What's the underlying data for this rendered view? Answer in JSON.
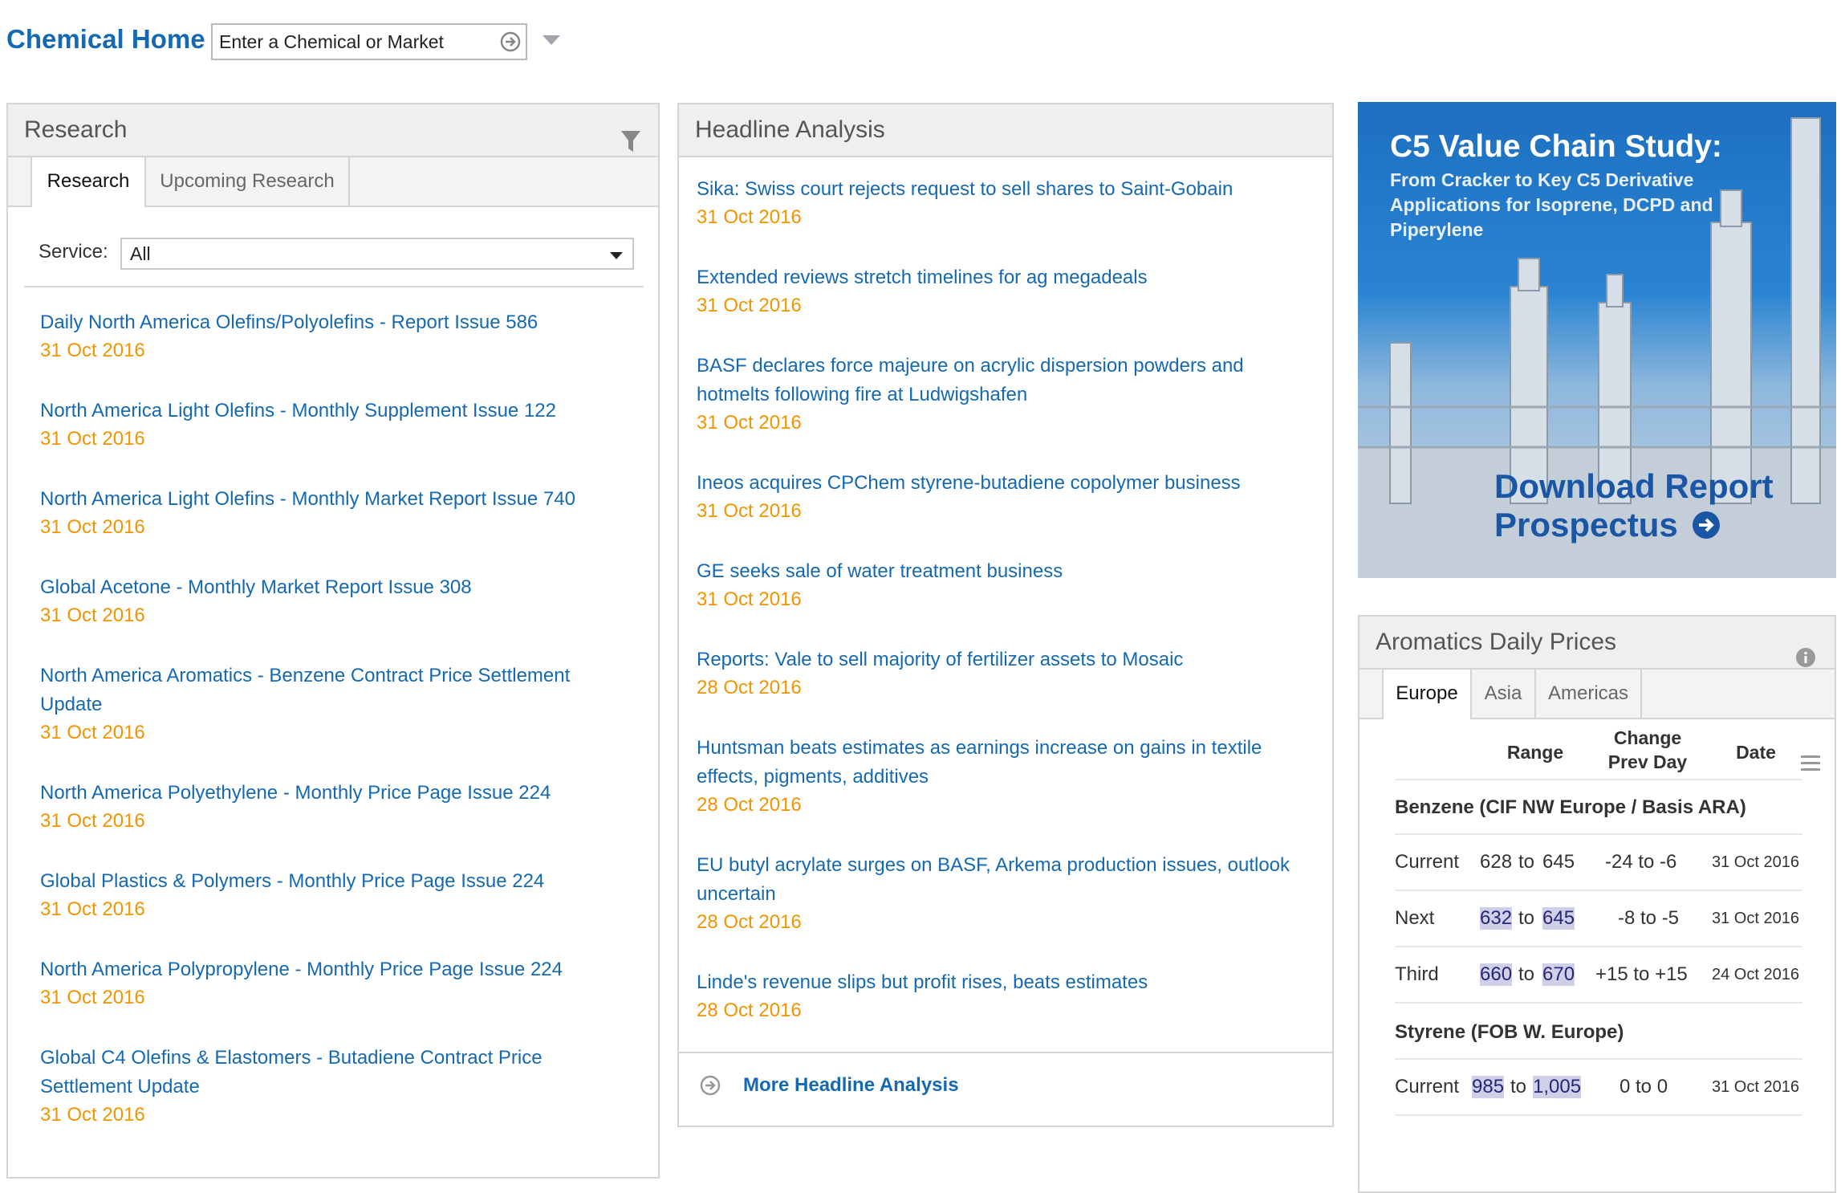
{
  "header": {
    "title": "Chemical Home",
    "search_placeholder": "Enter a Chemical or Market"
  },
  "research": {
    "title": "Research",
    "tabs": [
      "Research",
      "Upcoming Research"
    ],
    "service_label": "Service:",
    "service_value": "All",
    "items": [
      {
        "title": "Daily North America Olefins/Polyolefins - Report Issue 586",
        "date": "31 Oct 2016"
      },
      {
        "title": "North America Light Olefins - Monthly Supplement Issue 122",
        "date": "31 Oct 2016"
      },
      {
        "title": "North America Light Olefins - Monthly Market Report Issue 740",
        "date": "31 Oct 2016"
      },
      {
        "title": "Global Acetone - Monthly Market Report Issue 308",
        "date": "31 Oct 2016"
      },
      {
        "title": "North America Aromatics - Benzene Contract Price Settlement Update",
        "date": "31 Oct 2016"
      },
      {
        "title": "North America Polyethylene - Monthly Price Page Issue 224",
        "date": "31 Oct 2016"
      },
      {
        "title": "Global Plastics & Polymers - Monthly Price Page Issue 224",
        "date": "31 Oct 2016"
      },
      {
        "title": "North America Polypropylene - Monthly Price Page Issue 224",
        "date": "31 Oct 2016"
      },
      {
        "title": "Global C4 Olefins & Elastomers - Butadiene Contract Price Settlement Update",
        "date": "31 Oct 2016"
      }
    ]
  },
  "headlines": {
    "title": "Headline Analysis",
    "items": [
      {
        "title": "Sika: Swiss court rejects request to sell shares to Saint-Gobain",
        "date": "31 Oct 2016"
      },
      {
        "title": "Extended reviews stretch timelines for ag megadeals",
        "date": "31 Oct 2016"
      },
      {
        "title": "BASF declares force majeure on acrylic dispersion powders and hotmelts following fire at Ludwigshafen",
        "date": "31 Oct 2016"
      },
      {
        "title": "Ineos acquires CPChem styrene-butadiene copolymer business",
        "date": "31 Oct 2016"
      },
      {
        "title": "GE seeks sale of water treatment business",
        "date": "31 Oct 2016"
      },
      {
        "title": "Reports: Vale to sell majority of fertilizer assets to Mosaic",
        "date": "28 Oct 2016"
      },
      {
        "title": "Huntsman beats estimates as earnings increase on gains in textile effects, pigments, additives",
        "date": "28 Oct 2016"
      },
      {
        "title": "EU butyl acrylate surges on BASF, Arkema production issues, outlook uncertain",
        "date": "28 Oct 2016"
      },
      {
        "title": "Linde's revenue slips but profit rises, beats estimates",
        "date": "28 Oct 2016"
      }
    ],
    "more_label": "More Headline Analysis"
  },
  "ad": {
    "title": "C5 Value Chain Study:",
    "subtitle": "From Cracker to Key C5 Derivative Applications for Isoprene, DCPD and Piperylene",
    "cta_line1": "Download Report",
    "cta_line2": "Prospectus"
  },
  "prices": {
    "title": "Aromatics Daily Prices",
    "tabs": [
      "Europe",
      "Asia",
      "Americas"
    ],
    "columns": {
      "range": "Range",
      "change_1": "Change",
      "change_2": "Prev Day",
      "date": "Date"
    },
    "groups": [
      {
        "name": "Benzene (CIF NW Europe / Basis ARA)",
        "rows": [
          {
            "label": "Current",
            "low": "628",
            "to": "to",
            "high": "645",
            "change": "-24 to -6",
            "date": "31 Oct 2016"
          },
          {
            "label": "Next",
            "low": "632",
            "to": "to",
            "high": "645",
            "change": "-8 to -5",
            "date": "31 Oct 2016"
          },
          {
            "label": "Third",
            "low": "660",
            "to": "to",
            "high": "670",
            "change": "+15 to +15",
            "date": "24 Oct 2016"
          }
        ]
      },
      {
        "name": "Styrene (FOB W. Europe)",
        "rows": [
          {
            "label": "Current",
            "low": "985",
            "to": "to",
            "high": "1,005",
            "change": "0 to 0",
            "date": "31 Oct 2016"
          }
        ]
      }
    ]
  },
  "colors": {
    "link": "#1569b3",
    "date": "#f29400",
    "panel_header": "#efefef",
    "highlight": "#cfd0e8"
  }
}
